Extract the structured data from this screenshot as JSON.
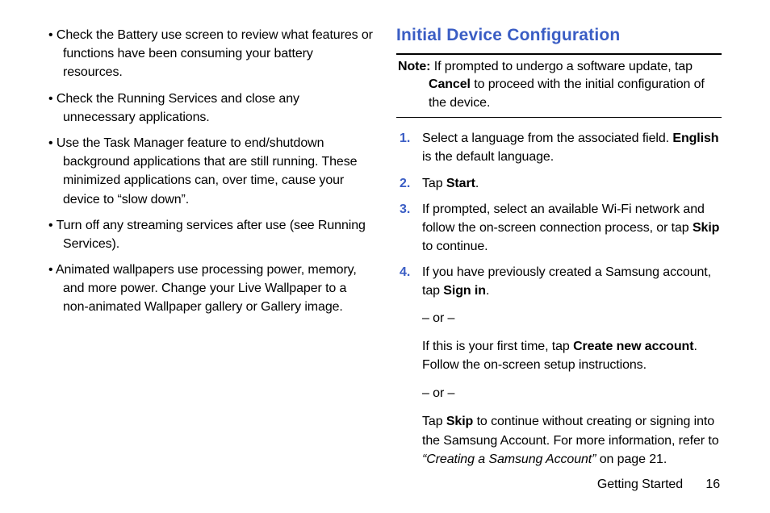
{
  "left": {
    "bullets": [
      "Check the Battery use screen to review what features or functions have been consuming your battery resources.",
      "Check the Running Services and close any unnecessary applications.",
      "Use the Task Manager feature to end/shutdown background applications that are still running. These minimized applications can, over time, cause your device to “slow down”.",
      "Turn off any streaming services after use (see Running Services).",
      "Animated wallpapers use processing power, memory, and more power. Change your Live Wallpaper to a non-animated Wallpaper gallery or Gallery image."
    ]
  },
  "right": {
    "heading": "Initial Device Configuration",
    "note_label": "Note:",
    "note_part1": " If prompted to undergo a software update, tap ",
    "note_bold": "Cancel",
    "note_part2": " to proceed with the initial configuration of the device.",
    "steps": {
      "s1a": "Select a language from the associated field. ",
      "s1b": "English",
      "s1c": " is the default language.",
      "s2a": "Tap ",
      "s2b": "Start",
      "s2c": ".",
      "s3a": "If prompted, select an available Wi-Fi network and follow the on-screen connection process, or tap ",
      "s3b": "Skip",
      "s3c": " to continue.",
      "s4a": "If you have previously created a Samsung account, tap ",
      "s4b": "Sign in",
      "s4c": ".",
      "s4or1": "– or –",
      "s4d1": "If this is your first time, tap ",
      "s4d2": "Create new account",
      "s4d3": ". Follow the on-screen setup instructions.",
      "s4or2": "– or –",
      "s4e1": "Tap ",
      "s4e2": "Skip",
      "s4e3": " to continue without creating or signing into the Samsung Account. For more information, refer to ",
      "s4e4": "“Creating a Samsung Account” ",
      "s4e5": " on page 21."
    }
  },
  "footer": {
    "section": "Getting Started",
    "page": "16"
  }
}
